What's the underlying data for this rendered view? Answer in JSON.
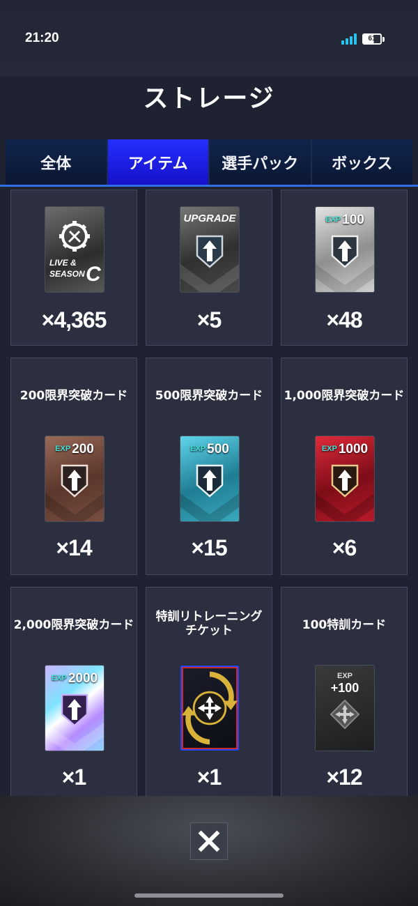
{
  "status": {
    "time": "21:20",
    "battery": "61"
  },
  "header": {
    "title": "ストレージ"
  },
  "tabs": [
    {
      "label": "全体",
      "active": false
    },
    {
      "label": "アイテム",
      "active": true
    },
    {
      "label": "選手パック",
      "active": false
    },
    {
      "label": "ボックス",
      "active": false
    }
  ],
  "items": [
    {
      "name": "",
      "count": "×4,365",
      "card": "live-season-c-card",
      "card_text": "LIVE & SEASON C"
    },
    {
      "name": "",
      "count": "×5",
      "card": "upgrade-card",
      "card_text": "UPGRADE"
    },
    {
      "name": "",
      "count": "×48",
      "card": "exp-100-card",
      "card_exp": "100"
    },
    {
      "name": "200限界突破カード",
      "count": "×14",
      "card": "exp-200-card",
      "card_exp": "200"
    },
    {
      "name": "500限界突破カード",
      "count": "×15",
      "card": "exp-500-card",
      "card_exp": "500"
    },
    {
      "name": "1,000限界突破カード",
      "count": "×6",
      "card": "exp-1000-card",
      "card_exp": "1000"
    },
    {
      "name": "2,000限界突破カード",
      "count": "×1",
      "card": "exp-2000-card",
      "card_exp": "2000"
    },
    {
      "name": "特訓リトレーニングチケット",
      "count": "×1",
      "card": "retraining-ticket-card"
    },
    {
      "name": "100特訓カード",
      "count": "×12",
      "card": "training-100-card",
      "card_exp": "+100"
    }
  ],
  "card_labels": {
    "exp": "EXP"
  },
  "colors": {
    "tab_active": "#2430ff",
    "tab_inactive": "#10244b",
    "exp_teal": "#43e3d7"
  },
  "icons": {
    "close": "close-icon"
  }
}
